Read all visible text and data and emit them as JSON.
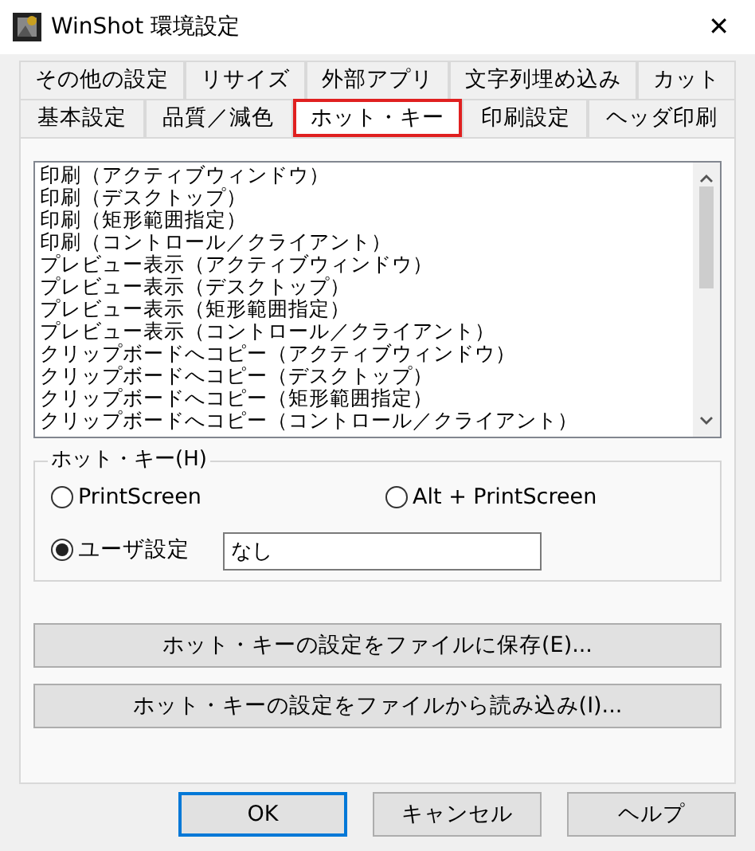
{
  "window": {
    "title": "WinShot 環境設定",
    "close": "✕"
  },
  "tab_rows": [
    {
      "tabs": [
        {
          "label": "その他の設定",
          "selected": false
        },
        {
          "label": "リサイズ",
          "selected": false
        },
        {
          "label": "外部アプリ",
          "selected": false
        },
        {
          "label": "文字列埋め込み",
          "selected": false
        },
        {
          "label": "カット",
          "selected": false
        }
      ]
    },
    {
      "tabs": [
        {
          "label": "基本設定",
          "selected": false
        },
        {
          "label": "品質／減色",
          "selected": false
        },
        {
          "label": "ホット・キー",
          "selected": true
        },
        {
          "label": "印刷設定",
          "selected": false
        },
        {
          "label": "ヘッダ印刷",
          "selected": false
        }
      ]
    }
  ],
  "action_list": [
    {
      "label": "印刷（アクティブウィンドウ）",
      "selected": false
    },
    {
      "label": "印刷（デスクトップ）",
      "selected": false
    },
    {
      "label": "印刷（矩形範囲指定）",
      "selected": false
    },
    {
      "label": "印刷（コントロール／クライアント）",
      "selected": false
    },
    {
      "label": "プレビュー表示（アクティブウィンドウ）",
      "selected": false
    },
    {
      "label": "プレビュー表示（デスクトップ）",
      "selected": false
    },
    {
      "label": "プレビュー表示（矩形範囲指定）",
      "selected": false
    },
    {
      "label": "プレビュー表示（コントロール／クライアント）",
      "selected": false
    },
    {
      "label": "クリップボードへコピー（アクティブウィンドウ）",
      "selected": false
    },
    {
      "label": "クリップボードへコピー（デスクトップ）",
      "selected": false
    },
    {
      "label": "クリップボードへコピー（矩形範囲指定）",
      "selected": false
    },
    {
      "label": "クリップボードへコピー（コントロール／クライアント）",
      "selected": false
    }
  ],
  "hotkey_group": {
    "title": "ホット・キー(H)",
    "options": [
      {
        "label": "PrintScreen",
        "selected": false
      },
      {
        "label": "Alt + PrintScreen",
        "selected": false
      },
      {
        "label": "ユーザ設定",
        "selected": true
      }
    ],
    "custom_value": "なし"
  },
  "file_buttons": [
    "ホット・キーの設定をファイルに保存(E)...",
    "ホット・キーの設定をファイルから読み込み(I)..."
  ],
  "dialog_buttons": [
    {
      "label": "OK",
      "default": true
    },
    {
      "label": "キャンセル",
      "default": false
    },
    {
      "label": "ヘルプ",
      "default": false
    }
  ]
}
